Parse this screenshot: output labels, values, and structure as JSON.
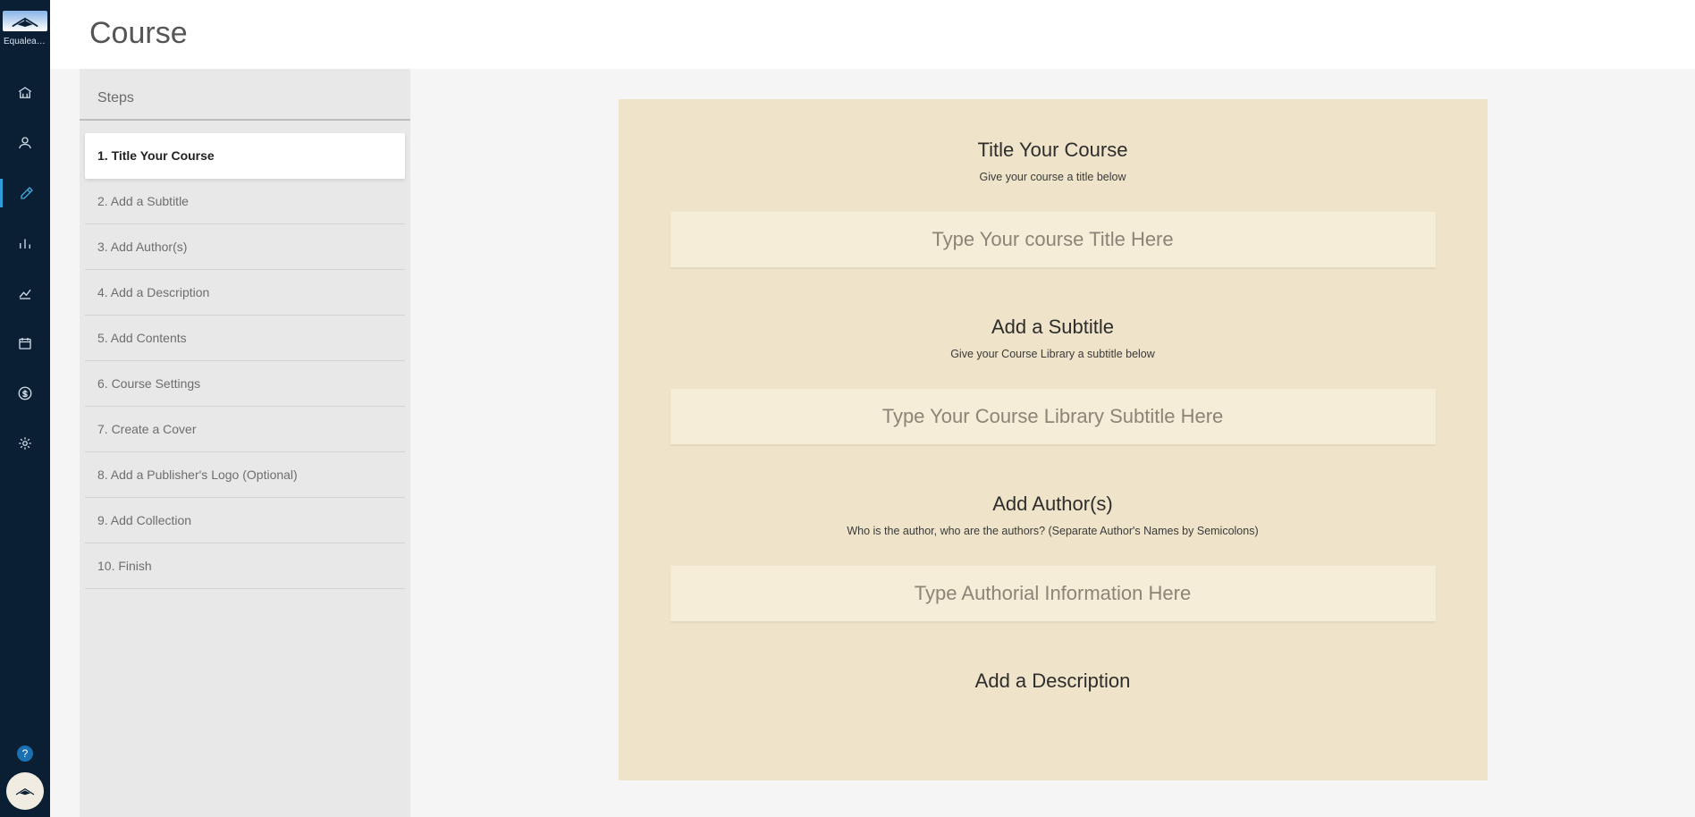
{
  "app": {
    "short_name": "Equalear…"
  },
  "page_title": "Course",
  "sidebar_nav": [
    {
      "id": "home",
      "icon": "bank-icon"
    },
    {
      "id": "users",
      "icon": "user-icon"
    },
    {
      "id": "author",
      "icon": "edit-icon",
      "active": true
    },
    {
      "id": "analytics",
      "icon": "bar-chart-icon"
    },
    {
      "id": "reports",
      "icon": "line-chart-icon"
    },
    {
      "id": "calendar",
      "icon": "calendar-icon"
    },
    {
      "id": "billing",
      "icon": "dollar-icon"
    },
    {
      "id": "settings",
      "icon": "gear-icon"
    }
  ],
  "help_glyph": "?",
  "steps_heading": "Steps",
  "steps": [
    {
      "label": "1. Title Your Course",
      "active": true
    },
    {
      "label": "2. Add a Subtitle"
    },
    {
      "label": "3. Add Author(s)"
    },
    {
      "label": "4. Add a Description"
    },
    {
      "label": "5. Add Contents"
    },
    {
      "label": "6. Course Settings"
    },
    {
      "label": "7. Create a Cover"
    },
    {
      "label": "8. Add a Publisher's Logo (Optional)"
    },
    {
      "label": "9. Add Collection"
    },
    {
      "label": "10. Finish"
    }
  ],
  "form": {
    "sections": [
      {
        "title": "Title Your Course",
        "subtitle": "Give your course a title below",
        "placeholder": "Type Your course Title Here",
        "value": ""
      },
      {
        "title": "Add a Subtitle",
        "subtitle": "Give your Course Library a subtitle below",
        "placeholder": "Type Your Course Library Subtitle Here",
        "value": ""
      },
      {
        "title": "Add Author(s)",
        "subtitle": "Who is the author, who are the authors? (Separate Author's Names by Semicolons)",
        "placeholder": "Type Authorial Information Here",
        "value": ""
      },
      {
        "title": "Add a Description",
        "subtitle": "",
        "placeholder": "",
        "value": ""
      }
    ]
  }
}
